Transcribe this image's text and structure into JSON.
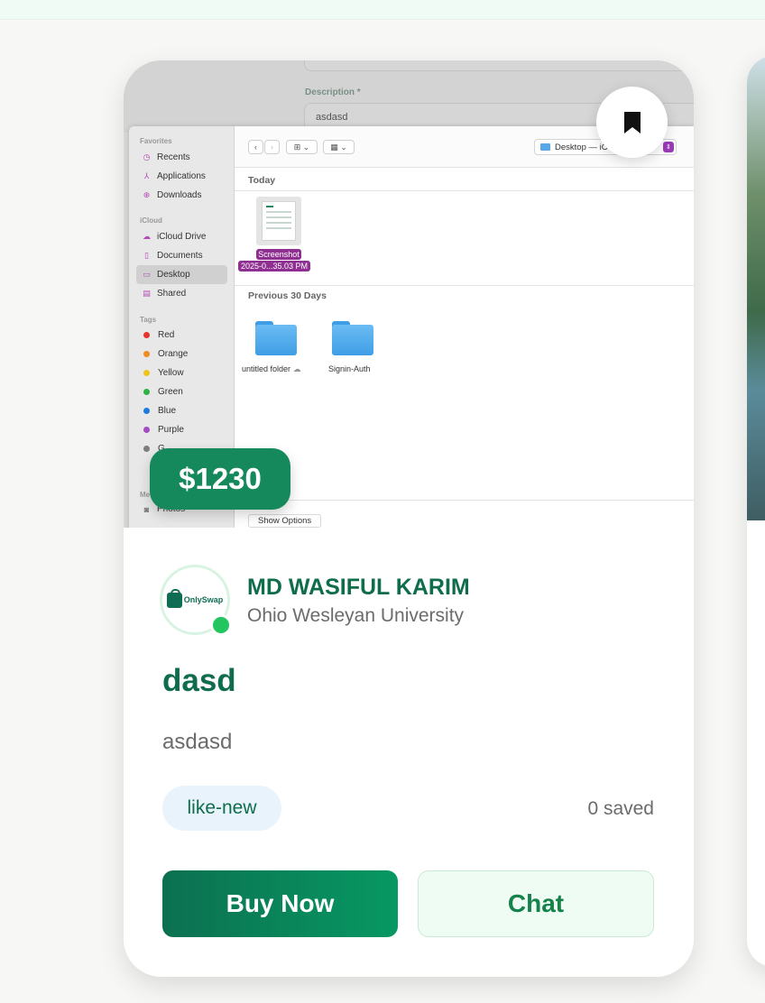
{
  "listing": {
    "price": "$1230",
    "seller": {
      "name": "MD WASIFUL KARIM",
      "school": "Ohio Wesleyan University",
      "avatar_logo_text": "OnlySwap"
    },
    "title": "dasd",
    "description": "asdasd",
    "condition": "like-new",
    "saved": "0 saved",
    "buy_label": "Buy Now",
    "chat_label": "Chat"
  },
  "image_content": {
    "form": {
      "description_label": "Description *",
      "description_value": "asdasd"
    },
    "sidebar": {
      "favorites_label": "Favorites",
      "favorites": [
        {
          "label": "Recents",
          "icon": "clock-icon"
        },
        {
          "label": "Applications",
          "icon": "applications-icon"
        },
        {
          "label": "Downloads",
          "icon": "download-icon"
        }
      ],
      "icloud_label": "iCloud",
      "icloud": [
        {
          "label": "iCloud Drive",
          "icon": "cloud-icon"
        },
        {
          "label": "Documents",
          "icon": "document-icon"
        },
        {
          "label": "Desktop",
          "icon": "desktop-icon"
        },
        {
          "label": "Shared",
          "icon": "shared-folder-icon"
        }
      ],
      "tags_label": "Tags",
      "tags": [
        {
          "label": "Red",
          "color": "#e5352b"
        },
        {
          "label": "Orange",
          "color": "#f08c1f"
        },
        {
          "label": "Yellow",
          "color": "#f2c21a"
        },
        {
          "label": "Green",
          "color": "#2fb344"
        },
        {
          "label": "Blue",
          "color": "#1f7ae0"
        },
        {
          "label": "Purple",
          "color": "#a44bc4"
        },
        {
          "label": "G",
          "color": "#7d7d7d"
        }
      ],
      "media_label": "Me",
      "media_item": "Photos"
    },
    "toolbar": {
      "location": "Desktop — iC"
    },
    "sections": {
      "today": "Today",
      "previous": "Previous 30 Days"
    },
    "files": {
      "screenshot_line1": "Screenshot",
      "screenshot_line2": "2025-0...35.03 PM",
      "folder1": "untitled folder",
      "folder2": "Signin-Auth"
    },
    "show_options": "Show Options"
  }
}
